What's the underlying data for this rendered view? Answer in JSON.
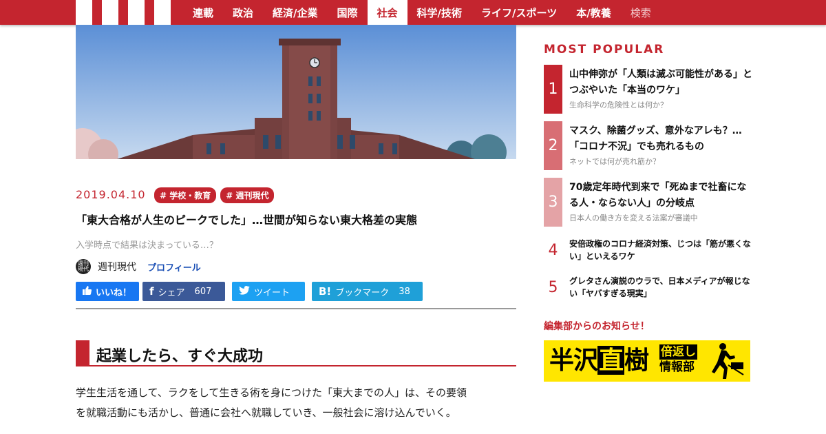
{
  "nav": {
    "items": [
      "連載",
      "政治",
      "経済/企業",
      "国際",
      "社会",
      "科学/技術",
      "ライフ/スポーツ",
      "本/教養"
    ],
    "active": "社会",
    "search_label": "検索"
  },
  "article": {
    "date": "2019.04.10",
    "tags": [
      "# 学校・教育",
      "# 週刊現代"
    ],
    "title": "「東大合格が人生のピークでした」…世間が知らない東大格差の実態",
    "lede": "入学時点で結果は決まっている…？",
    "author_avatar_text": "週刊現代",
    "author": "週刊現代",
    "profile_label": "プロフィール",
    "section_heading": "起業したら、すぐ大成功",
    "body_lines": [
      "学生生活を通して、ラクをして生きる術を身につけた「東大までの人」は、その要領",
      "を就職活動にも活かし、普通に会社へ就職していき、一般社会に溶け込んでいく。"
    ]
  },
  "share": {
    "like_label": "いいね！",
    "fb_label": "シェア",
    "fb_count": "607",
    "tw_label": "ツイート",
    "hb_label": "ブックマーク",
    "hb_count": "38",
    "like_icon": "thumbs-up-icon",
    "fb_icon": "facebook-icon",
    "tw_icon": "twitter-icon",
    "hb_icon": "hatena-bookmark-icon"
  },
  "sidebar": {
    "most_popular_title": "MOST POPULAR",
    "ranks": [
      {
        "num": "1",
        "headline": "山中伸弥が「人類は滅ぶ可能性がある」とつぶやいた「本当のワケ」",
        "sub": "生命科学の危険性とは何か？"
      },
      {
        "num": "2",
        "headline": "マスク、除菌グッズ、意外なアレも？…「コロナ不況」でも売れるもの",
        "sub": "ネットでは何が売れ筋か？"
      },
      {
        "num": "3",
        "headline": "70歳定年時代到来で「死ぬまで社畜になる人・ならない人」の分岐点",
        "sub": "日本人の働き方を変える法案が審議中"
      },
      {
        "num": "4",
        "headline": "安倍政権のコロナ経済対策、じつは「筋が悪くない」といえるワケ"
      },
      {
        "num": "5",
        "headline": "グレタさん演説のウラで、日本メディアが報じない「ヤバすぎる現実」"
      }
    ],
    "notice_title": "編集部からのお知らせ！",
    "banner": {
      "main_a": "半沢",
      "main_b": "直",
      "main_c": "樹",
      "side_top": "倍返し",
      "side_bottom": "情報部"
    }
  },
  "colors": {
    "brand_red": "#c4252f",
    "rank1": "#c4252f",
    "rank2": "#d86e74",
    "rank3": "#e4a3a6",
    "banner_yellow": "#ffe600"
  }
}
